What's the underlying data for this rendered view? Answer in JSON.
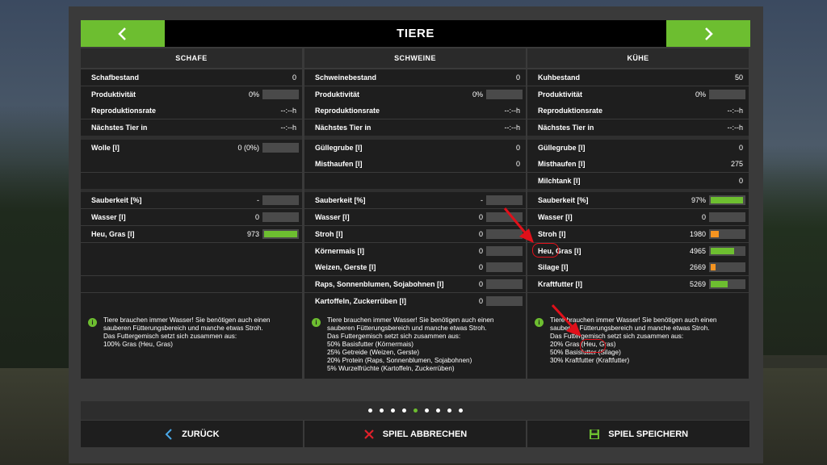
{
  "header": {
    "title": "TIERE",
    "prev_icon": "chevron-left-icon",
    "next_icon": "chevron-right-icon"
  },
  "colors": {
    "accent": "#6dbe30",
    "warning": "#f59420",
    "annotation": "#e0101a"
  },
  "columns": [
    {
      "title": "SCHAFE",
      "stats": [
        {
          "label": "Schafbestand",
          "value": "0"
        },
        {
          "label": "Produktivität",
          "value": "0%",
          "bar": 0
        },
        {
          "label": "Reproduktionsrate",
          "value": "--:--h"
        },
        {
          "label": "Nächstes Tier in",
          "value": "--:--h"
        }
      ],
      "products": [
        {
          "label": "Wolle [l]",
          "value": "0 (0%)",
          "bar": 0
        }
      ],
      "feed": [
        {
          "label": "Sauberkeit [%]",
          "value": "-",
          "bar": 0
        },
        {
          "label": "Wasser [l]",
          "value": "0",
          "bar": 0
        },
        {
          "label": "Heu, Gras [l]",
          "value": "973",
          "bar": 1.0,
          "bar_color": "green"
        }
      ],
      "info": "Tiere brauchen immer Wasser! Sie benötigen auch einen sauberen Fütterungsbereich und manche etwas Stroh.\nDas Futtergemisch setzt sich zusammen aus:\n100% Gras (Heu, Gras)"
    },
    {
      "title": "SCHWEINE",
      "stats": [
        {
          "label": "Schweinebestand",
          "value": "0"
        },
        {
          "label": "Produktivität",
          "value": "0%",
          "bar": 0
        },
        {
          "label": "Reproduktionsrate",
          "value": "--:--h"
        },
        {
          "label": "Nächstes Tier in",
          "value": "--:--h"
        }
      ],
      "products": [
        {
          "label": "Güllegrube [l]",
          "value": "0"
        },
        {
          "label": "Misthaufen [l]",
          "value": "0"
        }
      ],
      "feed": [
        {
          "label": "Sauberkeit [%]",
          "value": "-",
          "bar": 0
        },
        {
          "label": "Wasser [l]",
          "value": "0",
          "bar": 0
        },
        {
          "label": "Stroh [l]",
          "value": "0",
          "bar": 0
        },
        {
          "label": "Körnermais [l]",
          "value": "0",
          "bar": 0
        },
        {
          "label": "Weizen, Gerste [l]",
          "value": "0",
          "bar": 0
        },
        {
          "label": "Raps, Sonnenblumen, Sojabohnen [l]",
          "value": "0",
          "bar": 0
        },
        {
          "label": "Kartoffeln, Zuckerrüben [l]",
          "value": "0",
          "bar": 0
        }
      ],
      "info": "Tiere brauchen immer Wasser! Sie benötigen auch einen sauberen Fütterungsbereich und manche etwas Stroh.\nDas Futtergemisch setzt sich zusammen aus:\n50% Basisfutter (Körnermais)\n25% Getreide (Weizen, Gerste)\n20% Protein (Raps, Sonnenblumen, Sojabohnen)\n5% Wurzelfrüchte (Kartoffeln, Zuckerrüben)"
    },
    {
      "title": "KÜHE",
      "stats": [
        {
          "label": "Kuhbestand",
          "value": "50"
        },
        {
          "label": "Produktivität",
          "value": "0%",
          "bar": 0
        },
        {
          "label": "Reproduktionsrate",
          "value": "--:--h"
        },
        {
          "label": "Nächstes Tier in",
          "value": "--:--h"
        }
      ],
      "products": [
        {
          "label": "Güllegrube [l]",
          "value": "0"
        },
        {
          "label": "Misthaufen [l]",
          "value": "275"
        },
        {
          "label": "Milchtank [l]",
          "value": "0"
        }
      ],
      "feed": [
        {
          "label": "Sauberkeit [%]",
          "value": "97%",
          "bar": 0.97,
          "bar_color": "green"
        },
        {
          "label": "Wasser [l]",
          "value": "0",
          "bar": 0
        },
        {
          "label": "Stroh [l]",
          "value": "1980",
          "bar": 0.25,
          "bar_color": "orange"
        },
        {
          "label": "Heu, Gras [l]",
          "value": "4965",
          "bar": 0.7,
          "bar_color": "green"
        },
        {
          "label": "Silage [l]",
          "value": "2669",
          "bar": 0.15,
          "bar_color": "orange"
        },
        {
          "label": "Kraftfutter [l]",
          "value": "5269",
          "bar": 0.5,
          "bar_color": "green"
        }
      ],
      "info": "Tiere brauchen immer Wasser! Sie benötigen auch einen sauberen Fütterungsbereich und manche etwas Stroh.\nDas Futtergemisch setzt sich zusammen aus:\n20% Gras (Heu, Gras)\n50% Basisfutter (Silage)\n30% Kraftfutter (Kraftfutter)"
    }
  ],
  "pagination": {
    "count": 9,
    "active_index": 4
  },
  "footer": {
    "back_label": "ZURÜCK",
    "back_icon": "chevron-left-icon",
    "cancel_label": "SPIEL ABBRECHEN",
    "cancel_icon": "close-icon",
    "save_label": "SPIEL SPEICHERN",
    "save_icon": "floppy-disk-icon"
  }
}
